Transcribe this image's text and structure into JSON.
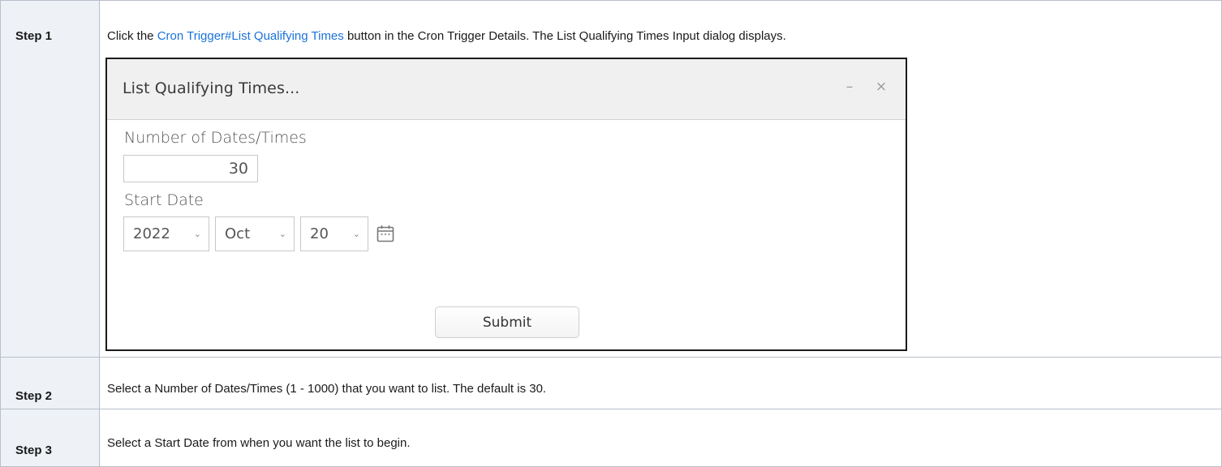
{
  "steps": [
    {
      "label": "Step 1",
      "text_before": "Click the ",
      "link_text": "Cron Trigger#List Qualifying Times",
      "text_after": " button in the Cron Trigger Details. The List Qualifying Times Input dialog displays."
    },
    {
      "label": "Step 2",
      "text": "Select a Number of Dates/Times (1 - 1000) that you want to list. The default is 30."
    },
    {
      "label": "Step 3",
      "text": "Select a Start Date from when you want the list to begin."
    }
  ],
  "dialog": {
    "title": "List Qualifying Times...",
    "minimize_glyph": "–",
    "close_glyph": "×",
    "number_label": "Number of Dates/Times",
    "number_value": "30",
    "start_date_label": "Start Date",
    "year": "2022",
    "month": "Oct",
    "day": "20",
    "caret_glyph": "⌄",
    "calendar_icon": "calendar-icon",
    "submit_label": "Submit"
  },
  "colors": {
    "link": "#1a73d9",
    "step_label_bg": "#eef1f6",
    "table_border": "#b8bfc9"
  }
}
